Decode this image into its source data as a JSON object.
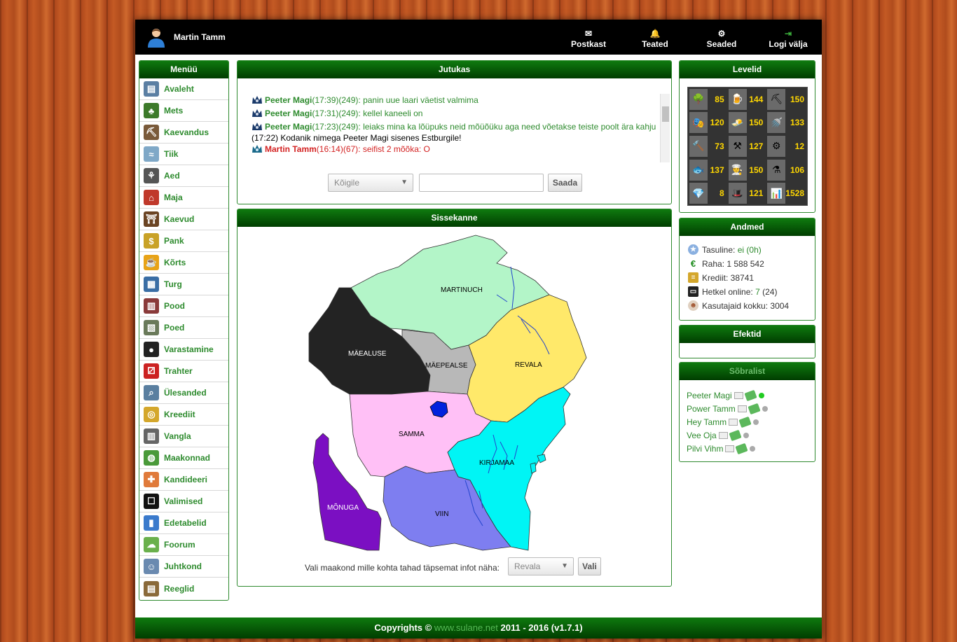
{
  "header": {
    "username": "Martin Tamm",
    "nav": [
      {
        "label": "Postkast",
        "icon": "mail-icon"
      },
      {
        "label": "Teated",
        "icon": "bell-icon"
      },
      {
        "label": "Seaded",
        "icon": "gear-icon"
      },
      {
        "label": "Logi välja",
        "icon": "logout-icon"
      }
    ]
  },
  "menu": {
    "title": "Menüü",
    "items": [
      {
        "label": "Avaleht",
        "icon": "newspaper-icon",
        "color": "#5b7fa3"
      },
      {
        "label": "Mets",
        "icon": "tree-icon",
        "color": "#3d7a2a"
      },
      {
        "label": "Kaevandus",
        "icon": "pickaxe-icon",
        "color": "#7a5a3a"
      },
      {
        "label": "Tiik",
        "icon": "fish-icon",
        "color": "#7fa8c7"
      },
      {
        "label": "Aed",
        "icon": "watering-can-icon",
        "color": "#555555"
      },
      {
        "label": "Maja",
        "icon": "house-icon",
        "color": "#c0392b"
      },
      {
        "label": "Kaevud",
        "icon": "well-icon",
        "color": "#6b4423"
      },
      {
        "label": "Pank",
        "icon": "money-icon",
        "color": "#c9a227"
      },
      {
        "label": "Kõrts",
        "icon": "beer-icon",
        "color": "#e8a317"
      },
      {
        "label": "Turg",
        "icon": "market-icon",
        "color": "#3a6ea5"
      },
      {
        "label": "Pood",
        "icon": "shop-icon",
        "color": "#8a3a3a"
      },
      {
        "label": "Poed",
        "icon": "shops-icon",
        "color": "#6a7a5a"
      },
      {
        "label": "Varastamine",
        "icon": "thief-icon",
        "color": "#222222"
      },
      {
        "label": "Trahter",
        "icon": "dice-icon",
        "color": "#cc2222"
      },
      {
        "label": "Ülesanded",
        "icon": "magnifier-icon",
        "color": "#5a7fa0"
      },
      {
        "label": "Kreediit",
        "icon": "coins-icon",
        "color": "#d4a72c"
      },
      {
        "label": "Vangla",
        "icon": "jail-icon",
        "color": "#666666"
      },
      {
        "label": "Maakonnad",
        "icon": "globe-icon",
        "color": "#4a9a3a"
      },
      {
        "label": "Kandideeri",
        "icon": "form-icon",
        "color": "#e07a3a"
      },
      {
        "label": "Valimised",
        "icon": "ballot-box-icon",
        "color": "#111111"
      },
      {
        "label": "Edetabelid",
        "icon": "bar-chart-icon",
        "color": "#3a7acc"
      },
      {
        "label": "Foorum",
        "icon": "chat-bubble-icon",
        "color": "#6ab04c"
      },
      {
        "label": "Juhtkond",
        "icon": "users-icon",
        "color": "#6a8ab0"
      },
      {
        "label": "Reeglid",
        "icon": "clipboard-icon",
        "color": "#8a6a3a"
      }
    ]
  },
  "chat": {
    "title": "Jutukas",
    "messages": [
      {
        "name": "Peeter Magi",
        "meta": "(17:39)(249)",
        "text": ": panin uue laari väetist valmima",
        "type": "user"
      },
      {
        "name": "Peeter Magi",
        "meta": "(17:31)(249)",
        "text": ": kellel kaneeli on",
        "type": "user"
      },
      {
        "name": "Peeter Magi",
        "meta": "(17:23)(249)",
        "text": ": leiaks mina ka lõüpuks neid mõüõüku aga need võetakse teiste poolt ära kahju",
        "type": "user"
      },
      {
        "name": "",
        "meta": "(17:22)",
        "text": " Kodanik nimega Peeter Magi sisenes Estburgile!",
        "type": "system"
      },
      {
        "name": "Martin Tamm",
        "meta": "(16:14)(67)",
        "text": ": seifist 2 mõõka: O",
        "type": "red"
      }
    ],
    "recipient": "Kõigile",
    "input_value": "",
    "send_label": "Saada"
  },
  "entry": {
    "title": "Sissekanne",
    "counties": [
      "MARTINUCH",
      "MÄEALUSE",
      "MÄEPEALSE",
      "REVALA",
      "SAMMA",
      "KIRJAMAA",
      "MÕNUGA",
      "VIIN"
    ],
    "select_prompt": "Vali maakond mille kohta tahad täpsemat infot näha:",
    "selected_county": "Revala",
    "select_button": "Vali",
    "colors": {
      "martinuch": "#b3f5c8",
      "maealuse": "#232323",
      "maepealse": "#b8b8b8",
      "revala": "#ffe96a",
      "samma": "#ffc0f6",
      "kirjamaa": "#00f5f5",
      "monuga": "#7b0fc2",
      "viin": "#7e7ef0",
      "lake": "#0022dd"
    }
  },
  "levels": {
    "title": "Levelid",
    "items": [
      {
        "icon": "tree-icon",
        "glyph": "🌳",
        "value": "85"
      },
      {
        "icon": "beer-icon",
        "glyph": "🍺",
        "value": "144"
      },
      {
        "icon": "pickaxe-icon",
        "glyph": "⛏",
        "value": "150"
      },
      {
        "icon": "mask-icon",
        "glyph": "🎭",
        "value": "120"
      },
      {
        "icon": "gold-bar-icon",
        "glyph": "🧈",
        "value": "150"
      },
      {
        "icon": "watering-can-icon",
        "glyph": "🚿",
        "value": "133"
      },
      {
        "icon": "hammer-icon",
        "glyph": "🔨",
        "value": "73"
      },
      {
        "icon": "tools-icon",
        "glyph": "⚒",
        "value": "127"
      },
      {
        "icon": "anvil-icon",
        "glyph": "⚙",
        "value": "12"
      },
      {
        "icon": "fish-icon",
        "glyph": "🐟",
        "value": "137"
      },
      {
        "icon": "chef-hat-icon",
        "glyph": "👨‍🍳",
        "value": "150"
      },
      {
        "icon": "flask-icon",
        "glyph": "⚗",
        "value": "106"
      },
      {
        "icon": "diamond-icon",
        "glyph": "💎",
        "value": "8"
      },
      {
        "icon": "witch-hat-icon",
        "glyph": "🎩",
        "value": "121"
      },
      {
        "icon": "bar-chart-icon",
        "glyph": "📊",
        "value": "1528"
      }
    ]
  },
  "andmed": {
    "title": "Andmed",
    "tasuline_label": "Tasuline:",
    "tasuline_value": "ei (0h)",
    "raha": "Raha: 1 588 542",
    "kreediit": "Krediit: 38741",
    "online_label": "Hetkel online:",
    "online_value": "7",
    "online_extra": "(24)",
    "kasutajaid": "Kasutajaid kokku: 3004"
  },
  "efektid": {
    "title": "Efektid"
  },
  "friends": {
    "title": "Sõbralist",
    "items": [
      {
        "name": "Peeter Magi",
        "online": true
      },
      {
        "name": "Power Tamm",
        "online": false
      },
      {
        "name": "Hey Tamm",
        "online": false
      },
      {
        "name": "Vee Oja",
        "online": false
      },
      {
        "name": "Pilvi Vihm",
        "online": false
      }
    ]
  },
  "footer": {
    "prefix": "Copyrights ©",
    "link": "www.sulane.net",
    "suffix": "2011 - 2016 (v1.7.1)"
  }
}
